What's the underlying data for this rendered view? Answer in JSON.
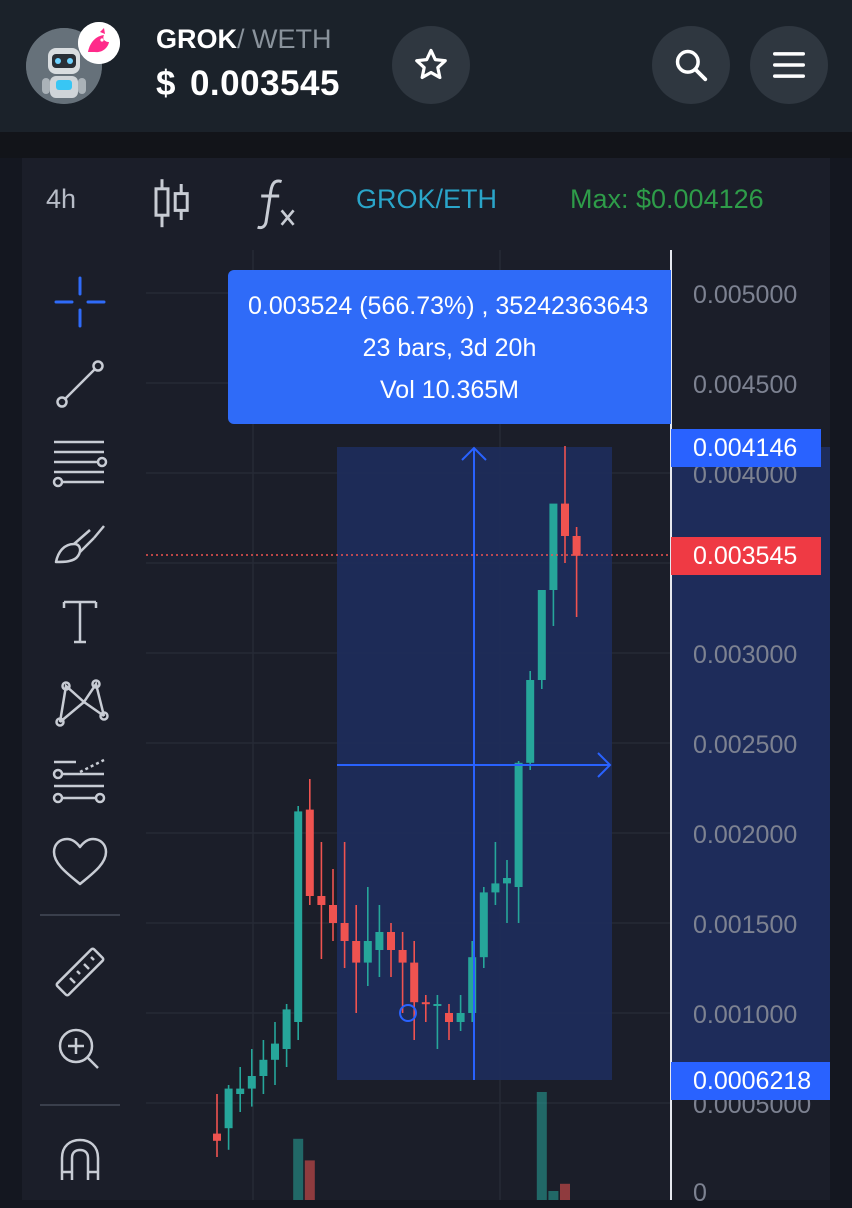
{
  "header": {
    "pair_base": "GROK",
    "pair_separator": "/",
    "pair_quote": "WETH",
    "price_symbol": "$",
    "price": "0.003545",
    "avatar_icon": "robot-avatar-icon",
    "badge_icon": "uniswap-icon",
    "buttons": [
      "star-icon",
      "search-icon",
      "menu-icon"
    ]
  },
  "toolbar": {
    "interval": "4h",
    "pair": "GROK/ETH",
    "max_label": "Max: $0.004126",
    "chart_type_icon": "candlestick-icon",
    "indicator_icon": "fx-icon"
  },
  "drawing_tools": [
    "crosshair-icon",
    "trend-line-icon",
    "horizontal-lines-icon",
    "brush-icon",
    "text-icon",
    "pattern-icon",
    "fib-lines-icon",
    "favorite-heart-icon",
    "ruler-icon",
    "zoom-in-icon",
    "magnet-icon"
  ],
  "tooltip": {
    "line1": "0.003524 (566.73%) , 35242363643",
    "line2": "23 bars, 3d 20h",
    "line3": "Vol 10.365M"
  },
  "price_scale": {
    "labels": [
      "0.005000",
      "0.004500",
      "0.004000",
      "0.003000",
      "0.002500",
      "0.002000",
      "0.001500",
      "0.001000",
      "0.0005000",
      "0"
    ],
    "range_high_tag": "0.004146",
    "current_price_tag": "0.003545",
    "range_low_tag": "0.0006218"
  },
  "colors": {
    "up": "#26a69a",
    "down": "#ef5350",
    "accent": "#2962ff",
    "range_fill": "#1e2c5a",
    "max_green": "#2e9c49",
    "pair_teal": "#2aa5c9"
  },
  "chart_data": {
    "type": "candlestick",
    "symbol": "GROK/ETH",
    "interval": "4h",
    "ylim": [
      0,
      0.0052
    ],
    "candles": [
      {
        "o": 0.00033,
        "h": 0.00055,
        "l": 0.0002,
        "c": 0.00029
      },
      {
        "o": 0.00036,
        "h": 0.0006,
        "l": 0.00024,
        "c": 0.00058
      },
      {
        "o": 0.00055,
        "h": 0.0007,
        "l": 0.00045,
        "c": 0.00058
      },
      {
        "o": 0.00058,
        "h": 0.0008,
        "l": 0.00048,
        "c": 0.00065
      },
      {
        "o": 0.00065,
        "h": 0.00085,
        "l": 0.00055,
        "c": 0.00074
      },
      {
        "o": 0.00074,
        "h": 0.00095,
        "l": 0.0006,
        "c": 0.00083
      },
      {
        "o": 0.0008,
        "h": 0.00105,
        "l": 0.0007,
        "c": 0.00102
      },
      {
        "o": 0.00095,
        "h": 0.00215,
        "l": 0.00085,
        "c": 0.00212
      },
      {
        "o": 0.00213,
        "h": 0.0023,
        "l": 0.0016,
        "c": 0.00165
      },
      {
        "o": 0.00165,
        "h": 0.00195,
        "l": 0.0013,
        "c": 0.0016
      },
      {
        "o": 0.0016,
        "h": 0.0018,
        "l": 0.0014,
        "c": 0.0015
      },
      {
        "o": 0.0015,
        "h": 0.00195,
        "l": 0.00125,
        "c": 0.0014
      },
      {
        "o": 0.0014,
        "h": 0.0016,
        "l": 0.001,
        "c": 0.00128
      },
      {
        "o": 0.00128,
        "h": 0.0017,
        "l": 0.00115,
        "c": 0.0014
      },
      {
        "o": 0.00135,
        "h": 0.0016,
        "l": 0.0012,
        "c": 0.00145
      },
      {
        "o": 0.00145,
        "h": 0.0015,
        "l": 0.0012,
        "c": 0.00135
      },
      {
        "o": 0.00135,
        "h": 0.00145,
        "l": 0.001,
        "c": 0.00128
      },
      {
        "o": 0.00128,
        "h": 0.0014,
        "l": 0.00085,
        "c": 0.00106
      },
      {
        "o": 0.00106,
        "h": 0.0011,
        "l": 0.00095,
        "c": 0.00105
      },
      {
        "o": 0.00105,
        "h": 0.0011,
        "l": 0.0008,
        "c": 0.00105
      },
      {
        "o": 0.001,
        "h": 0.00105,
        "l": 0.00085,
        "c": 0.00095
      },
      {
        "o": 0.00095,
        "h": 0.0011,
        "l": 0.0009,
        "c": 0.001
      },
      {
        "o": 0.001,
        "h": 0.0014,
        "l": 0.00095,
        "c": 0.00131
      },
      {
        "o": 0.00131,
        "h": 0.0017,
        "l": 0.00125,
        "c": 0.00167
      },
      {
        "o": 0.00167,
        "h": 0.00195,
        "l": 0.0016,
        "c": 0.00172
      },
      {
        "o": 0.00172,
        "h": 0.00185,
        "l": 0.0015,
        "c": 0.00175
      },
      {
        "o": 0.0017,
        "h": 0.0024,
        "l": 0.0015,
        "c": 0.00239
      },
      {
        "o": 0.00239,
        "h": 0.0029,
        "l": 0.00235,
        "c": 0.00285
      },
      {
        "o": 0.00285,
        "h": 0.00335,
        "l": 0.0028,
        "c": 0.00335
      },
      {
        "o": 0.00335,
        "h": 0.00375,
        "l": 0.00315,
        "c": 0.00383
      },
      {
        "o": 0.00383,
        "h": 0.00415,
        "l": 0.0035,
        "c": 0.00365
      },
      {
        "o": 0.00365,
        "h": 0.0037,
        "l": 0.0032,
        "c": 0.00354
      }
    ],
    "volume": [
      0,
      0,
      0,
      0,
      0,
      0,
      0,
      0.34,
      0.22,
      0,
      0,
      0,
      0,
      0,
      0,
      0,
      0,
      0,
      0,
      0,
      0,
      0,
      0,
      0,
      0,
      0,
      0,
      0,
      0.6,
      0.05,
      0.09,
      0
    ],
    "measure_range": {
      "low": 0.0006218,
      "high": 0.004146,
      "bars": 23
    },
    "current_price": 0.003545,
    "grid": true
  }
}
